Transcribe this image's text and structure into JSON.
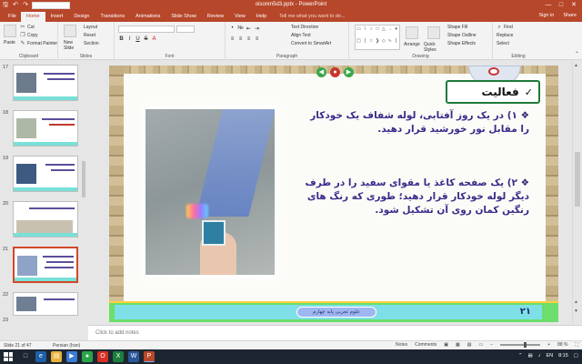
{
  "window": {
    "title": "oisonm5d3.pptx - PowerPoint",
    "controls": [
      "—",
      "□",
      "✕"
    ]
  },
  "ribbon_tabs": [
    "File",
    "Home",
    "Insert",
    "Design",
    "Transitions",
    "Animations",
    "Slide Show",
    "Review",
    "View",
    "Help"
  ],
  "tell_me": "Tell me what you want to do...",
  "account": {
    "signin": "Sign in",
    "share": "Share"
  },
  "ribbon": {
    "clipboard": {
      "label": "Clipboard",
      "paste": "Paste",
      "cut": "Cut",
      "copy": "Copy",
      "format_painter": "Format Painter"
    },
    "slides": {
      "label": "Slides",
      "new_slide": "New Slide",
      "layout": "Layout",
      "reset": "Reset",
      "section": "Section"
    },
    "font": {
      "label": "Font"
    },
    "paragraph": {
      "label": "Paragraph",
      "text_direction": "Text Direction",
      "align_text": "Align Text",
      "smartart": "Convert to SmartArt"
    },
    "drawing": {
      "label": "Drawing",
      "arrange": "Arrange",
      "quick_styles": "Quick Styles",
      "shape_fill": "Shape Fill",
      "shape_outline": "Shape Outline",
      "shape_effects": "Shape Effects"
    },
    "editing": {
      "label": "Editing",
      "find": "Find",
      "replace": "Replace",
      "select": "Select"
    }
  },
  "thumbnails": [
    {
      "num": "17"
    },
    {
      "num": "18"
    },
    {
      "num": "19"
    },
    {
      "num": "20"
    },
    {
      "num": "21",
      "active": true
    },
    {
      "num": "22"
    },
    {
      "num": "23"
    }
  ],
  "slide": {
    "activity_label": "فعالیت",
    "checkmark": "✓",
    "bullet": "❖",
    "item1": "۱) در یک روز آفتابی، لوله شفاف یک خودکار را مقابل نور خورشید قرار دهید.",
    "item2": "۲) یک صفحه کاغذ یا مقوای سفید را در طرف دیگر لوله خودکار قرار دهید؛ طوری که رنگ های رنگین کمان روی آن تشکیل شود.",
    "footer_label": "علوم تجربی پایه چهارم",
    "page_number": "۲۱"
  },
  "notes_placeholder": "Click to add notes",
  "status": {
    "slide_of": "Slide 21 of 47",
    "language": "Persian (Iran)",
    "notes": "Notes",
    "comments": "Comments",
    "zoom": "88 %"
  },
  "taskbar": {
    "lang": "EN",
    "time": "8:15"
  },
  "colors": {
    "accent": "#b7472a",
    "slide_text": "#3b2a8a",
    "footer_green": "#6cde6c",
    "footer_cyan": "#7ee0e6"
  }
}
